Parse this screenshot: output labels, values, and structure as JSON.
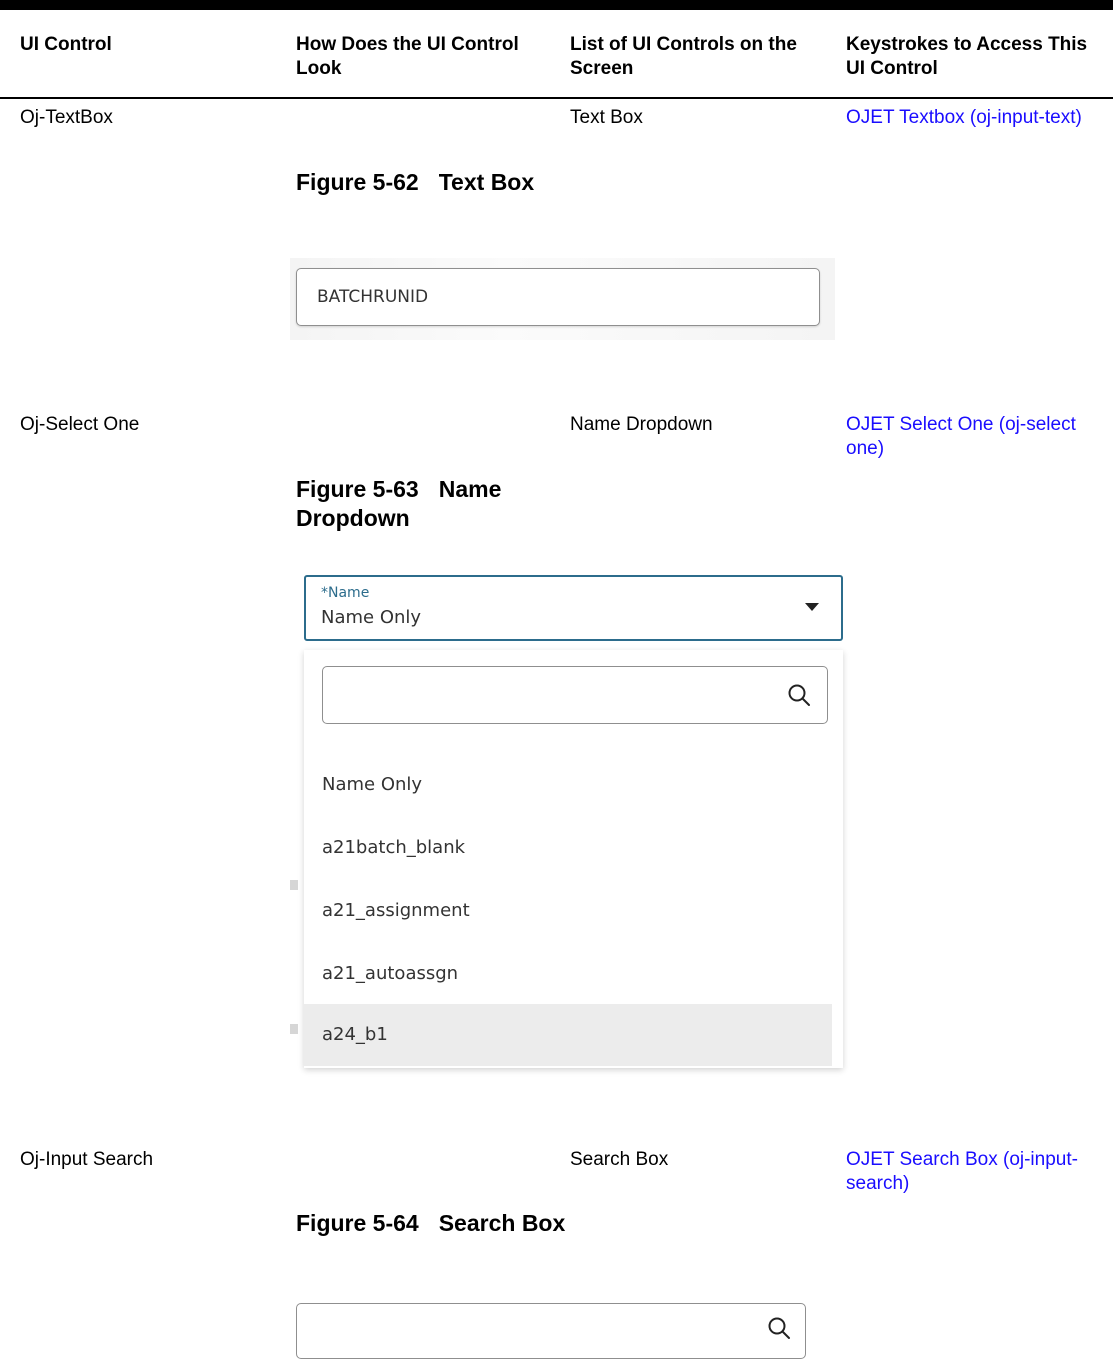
{
  "headers": {
    "col1": "UI Control",
    "col2": "How Does the UI Control Look",
    "col3": "List of UI Controls on the Screen",
    "col4": "Keystrokes to Access This UI Control"
  },
  "rows": [
    {
      "control": "Oj-TextBox",
      "figure_number": "Figure 5-62",
      "figure_title": "Text Box",
      "list_item": "Text Box",
      "link": "OJET Textbox (oj-input-text)"
    },
    {
      "control": "Oj-Select One",
      "figure_number": "Figure 5-63",
      "figure_title": "Name Dropdown",
      "list_item": "Name Dropdown",
      "link": "OJET Select One (oj-select one)"
    },
    {
      "control": "Oj-Input Search",
      "figure_number": "Figure 5-64",
      "figure_title": "Search Box",
      "list_item": "Search Box",
      "link": "OJET Search Box (oj-input-search)"
    }
  ],
  "textbox_figure": {
    "value": "BATCHRUNID"
  },
  "dropdown_figure": {
    "label": "*Name",
    "selected": "Name Only",
    "options": [
      "Name Only",
      "a21batch_blank",
      "a21_assignment",
      "a21_autoassgn",
      "a24_b1"
    ],
    "highlighted_option": "a24_b1"
  },
  "search_figure": {
    "value": ""
  },
  "colors": {
    "link": "#1a0dff",
    "focus_border": "#2c6c8c",
    "highlight": "#ececec"
  },
  "icons": {
    "search": "search-icon",
    "dropdown_arrow": "chevron-down-icon"
  }
}
